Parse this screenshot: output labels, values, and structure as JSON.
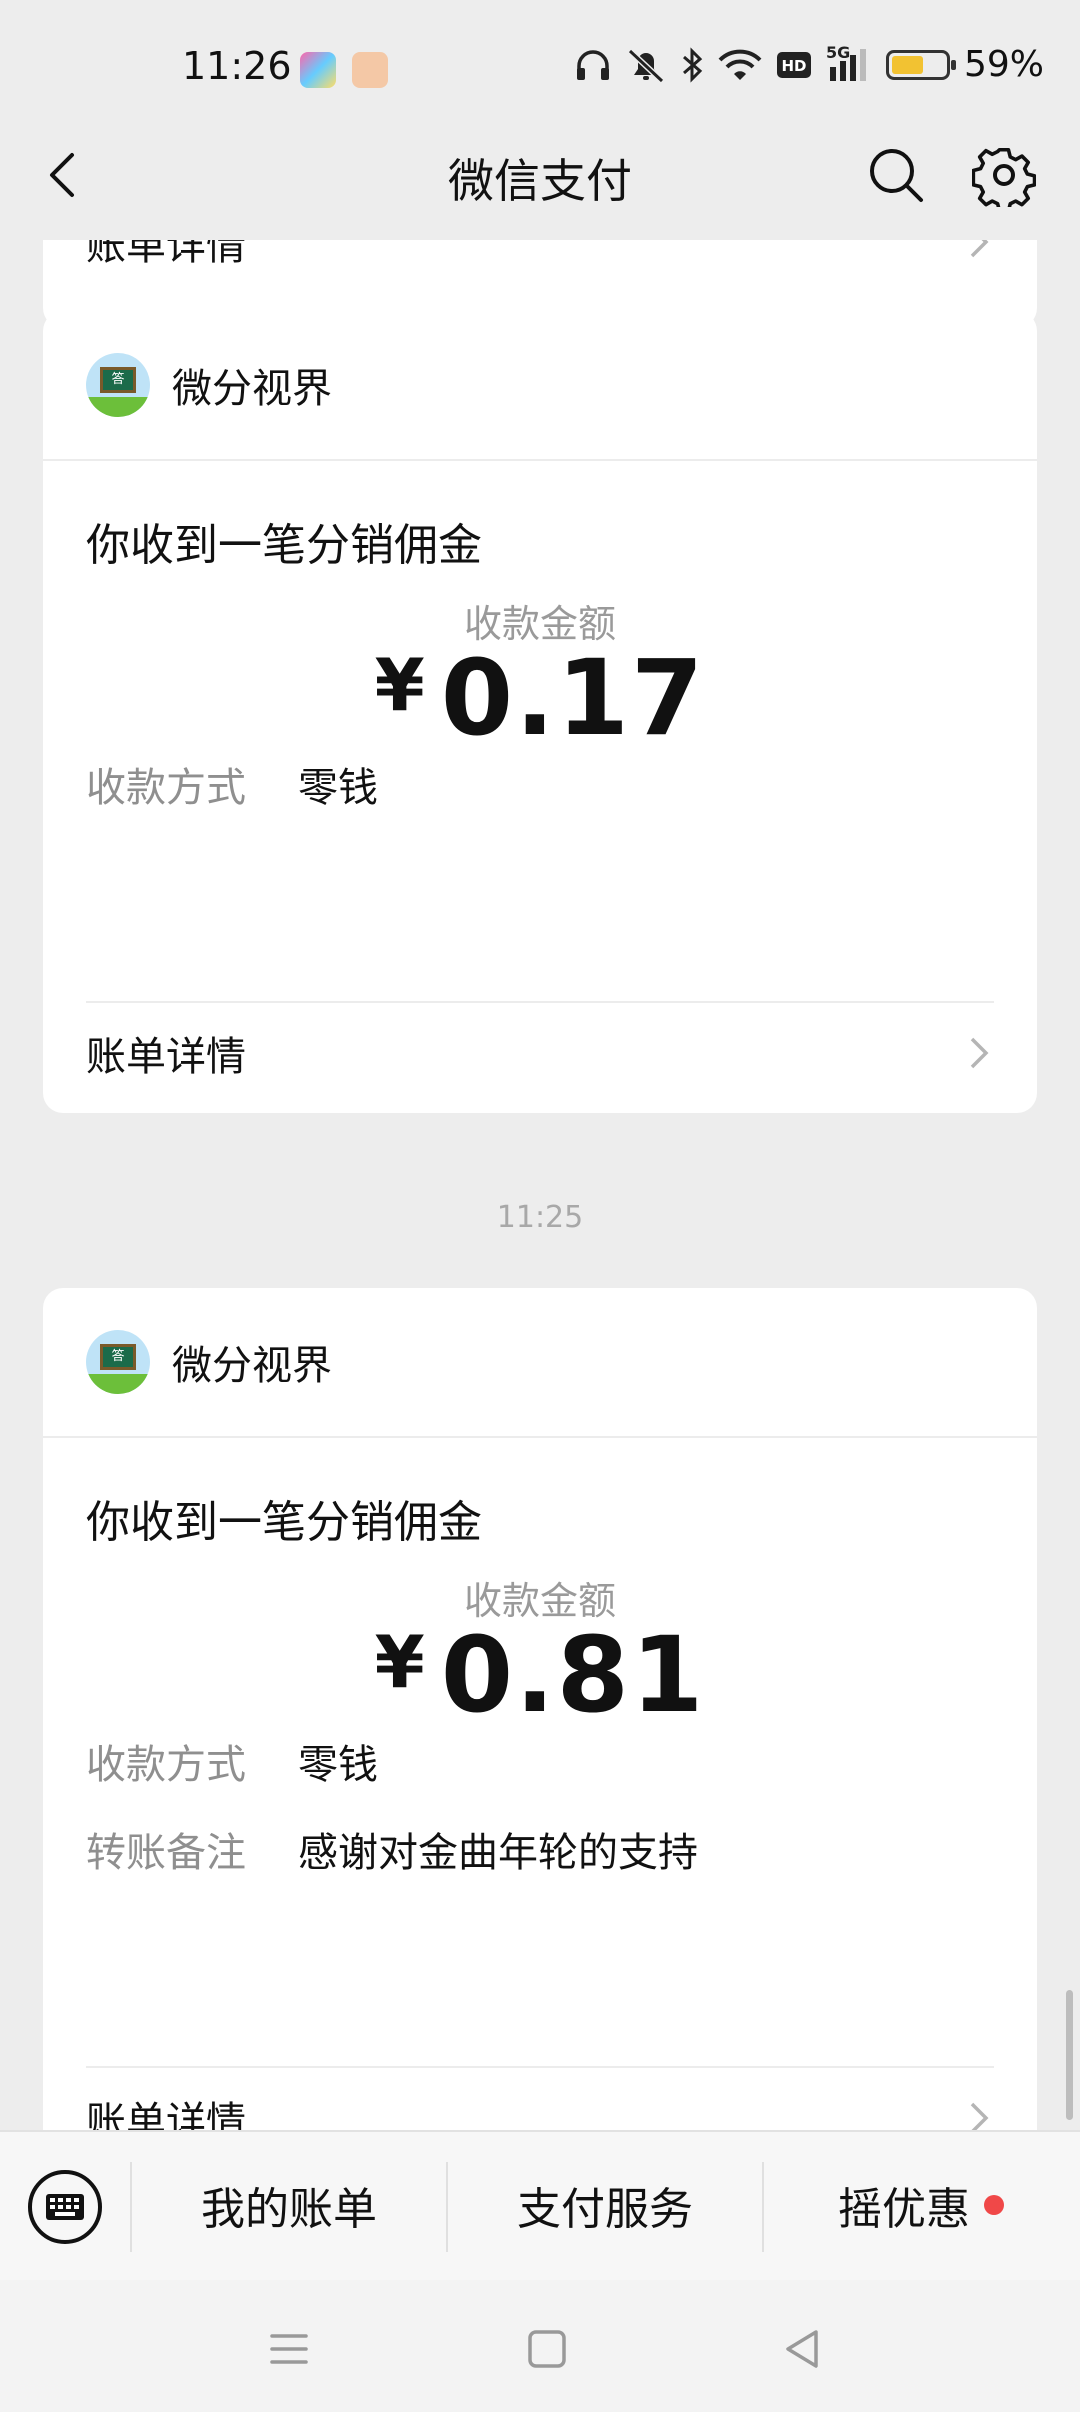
{
  "status_bar": {
    "time": "11:26",
    "signal_label": "5G",
    "battery_percent_text": "59%",
    "battery_level": 0.59,
    "icons": [
      "headphones-icon",
      "mute-icon",
      "bluetooth-icon",
      "wifi-icon",
      "hd-icon",
      "signal-icon",
      "battery-icon"
    ]
  },
  "header": {
    "title": "微信支付",
    "back_icon": "chevron-left-icon",
    "search_icon": "search-icon",
    "settings_icon": "gear-icon"
  },
  "top_card": {
    "detail_label": "账单详情"
  },
  "messages": [
    {
      "merchant": "微分视界",
      "headline": "你收到一笔分销佣金",
      "amount_label": "收款金额",
      "currency": "¥",
      "amount": "0.17",
      "fields": [
        {
          "key": "收款方式",
          "value": "零钱"
        }
      ],
      "detail_label": "账单详情"
    },
    {
      "timestamp": "11:25",
      "merchant": "微分视界",
      "headline": "你收到一笔分销佣金",
      "amount_label": "收款金额",
      "currency": "¥",
      "amount": "0.81",
      "fields": [
        {
          "key": "收款方式",
          "value": "零钱"
        },
        {
          "key": "转账备注",
          "value": "感谢对金曲年轮的支持"
        }
      ],
      "detail_label": "账单详情"
    }
  ],
  "bottom_menu": {
    "keyboard_icon": "keyboard-icon",
    "items": [
      {
        "label": "我的账单"
      },
      {
        "label": "支付服务"
      },
      {
        "label": "摇优惠",
        "has_dot": true
      }
    ]
  },
  "avatar_badge_text": "答",
  "colors": {
    "background": "#ededed",
    "card": "#ffffff",
    "red_dot": "#f04848",
    "battery": "#f2c232"
  }
}
